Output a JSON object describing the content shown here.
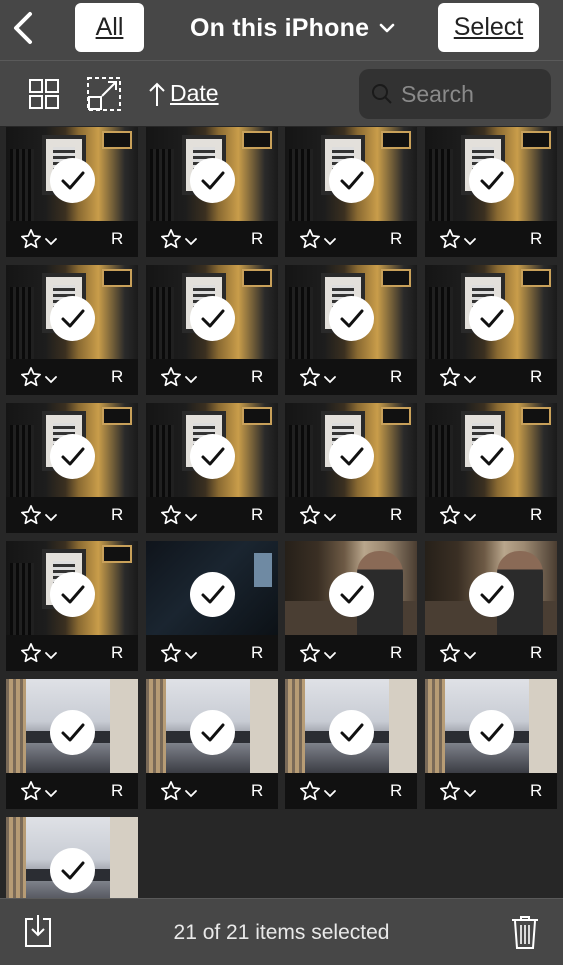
{
  "header": {
    "back_icon": "chevron-left-icon",
    "all_label": "All",
    "title": "On this iPhone",
    "title_icon": "chevron-down-icon",
    "select_label": "Select"
  },
  "toolbar": {
    "grid_icon": "grid-view-icon",
    "crop_icon": "resize-frame-icon",
    "sort_icon": "arrow-up-icon",
    "sort_label": "Date",
    "search_placeholder": "Search",
    "search_icon": "search-icon"
  },
  "items": [
    {
      "scene": "a",
      "rating": "R"
    },
    {
      "scene": "a",
      "rating": "R"
    },
    {
      "scene": "a",
      "rating": "R"
    },
    {
      "scene": "a",
      "rating": "R"
    },
    {
      "scene": "a",
      "rating": "R"
    },
    {
      "scene": "a",
      "rating": "R"
    },
    {
      "scene": "a",
      "rating": "R"
    },
    {
      "scene": "a",
      "rating": "R"
    },
    {
      "scene": "a",
      "rating": "R"
    },
    {
      "scene": "a",
      "rating": "R"
    },
    {
      "scene": "a",
      "rating": "R"
    },
    {
      "scene": "a",
      "rating": "R"
    },
    {
      "scene": "a",
      "rating": "R"
    },
    {
      "scene": "dark",
      "rating": "R"
    },
    {
      "scene": "cafe",
      "rating": "R"
    },
    {
      "scene": "cafe",
      "rating": "R"
    },
    {
      "scene": "office",
      "rating": "R"
    },
    {
      "scene": "office",
      "rating": "R"
    },
    {
      "scene": "office",
      "rating": "R"
    },
    {
      "scene": "office",
      "rating": "R"
    },
    {
      "scene": "office",
      "rating": "R"
    }
  ],
  "footer": {
    "status": "21 of 21 items selected",
    "export_icon": "export-tray-icon",
    "trash_icon": "trash-icon"
  },
  "colors": {
    "bar": "#474747",
    "background": "#272727",
    "check": "#ffffff"
  }
}
